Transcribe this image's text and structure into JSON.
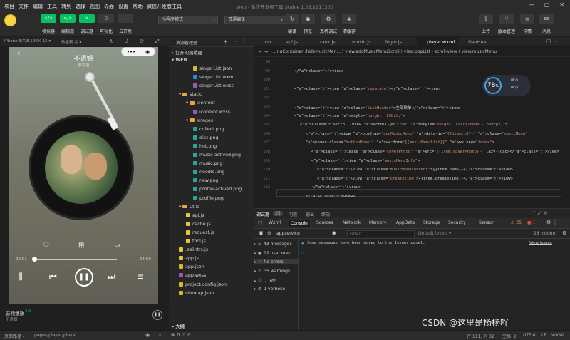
{
  "menus": [
    "项目",
    "文件",
    "编辑",
    "工具",
    "转到",
    "选择",
    "视图",
    "界面",
    "设置",
    "帮助",
    "微信开发者工具"
  ],
  "window_title": "web - 微信开发者工具 Stable 1.05.2111300",
  "toolbar": {
    "modes": [
      {
        "glyph": "</>",
        "label": "模拟器"
      },
      {
        "glyph": "</>",
        "label": "编辑器"
      },
      {
        "glyph": "≡",
        "label": "调试器"
      },
      {
        "glyph": "◫",
        "label": "可视化"
      },
      {
        "glyph": "☁",
        "label": "云开发"
      }
    ],
    "compile_mode": "小程序模式",
    "compile_type": "普通编译",
    "actions_mid": [
      {
        "icon": "↻",
        "label": "编译"
      },
      {
        "icon": "◉",
        "label": "预览"
      },
      {
        "icon": "⚙",
        "label": "真机调试"
      },
      {
        "icon": "◈",
        "label": "清缓存"
      }
    ],
    "actions_right": [
      {
        "icon": "⇪",
        "label": "上传"
      },
      {
        "icon": "⑂",
        "label": "版本管理"
      },
      {
        "icon": "≡",
        "label": "详情"
      },
      {
        "icon": "✉",
        "label": "消息"
      }
    ]
  },
  "simulator": {
    "device": "iPhone 6/7/8 100% 15 ▾",
    "hotreload": "热重载 关 ▾",
    "song_title": "不遗憾",
    "artist": "李荣浩",
    "time_current": "00:01",
    "time_total": "04:59",
    "progress": 0.02,
    "mini_title": "音频播放",
    "mini_sub": "不遗憾",
    "mini_extra": "4.0"
  },
  "explorer": {
    "title": "资源管理器",
    "open_editors": "打开的编辑器",
    "root": "WEB",
    "items": [
      {
        "name": "singerList.json",
        "type": "json",
        "indent": 3
      },
      {
        "name": "singerList.wxml",
        "type": "wxml",
        "indent": 3
      },
      {
        "name": "singerList.wxss",
        "type": "wxss",
        "indent": 3
      },
      {
        "name": "static",
        "type": "folder",
        "indent": 1
      },
      {
        "name": "iconfont",
        "type": "folder",
        "indent": 2
      },
      {
        "name": "iconfont.wxss",
        "type": "wxss",
        "indent": 3
      },
      {
        "name": "images",
        "type": "folder",
        "indent": 2
      },
      {
        "name": "collect.png",
        "type": "png",
        "indent": 3
      },
      {
        "name": "disc.png",
        "type": "png",
        "indent": 3
      },
      {
        "name": "hot.png",
        "type": "png",
        "indent": 3
      },
      {
        "name": "music-actived.png",
        "type": "png",
        "indent": 3
      },
      {
        "name": "music.png",
        "type": "png",
        "indent": 3
      },
      {
        "name": "needle.png",
        "type": "png",
        "indent": 3
      },
      {
        "name": "new.png",
        "type": "png",
        "indent": 3
      },
      {
        "name": "profile-actived.png",
        "type": "png",
        "indent": 3
      },
      {
        "name": "profile.png",
        "type": "png",
        "indent": 3
      },
      {
        "name": "utils",
        "type": "folder",
        "indent": 1
      },
      {
        "name": "api.js",
        "type": "js",
        "indent": 2
      },
      {
        "name": "cache.js",
        "type": "js",
        "indent": 2
      },
      {
        "name": "request.js",
        "type": "js",
        "indent": 2
      },
      {
        "name": "tool.js",
        "type": "js",
        "indent": 2
      },
      {
        "name": ".eslintrc.js",
        "type": "js",
        "indent": 1
      },
      {
        "name": "app.js",
        "type": "js",
        "indent": 1
      },
      {
        "name": "app.json",
        "type": "json",
        "indent": 1
      },
      {
        "name": "app.wxss",
        "type": "wxss",
        "indent": 1
      },
      {
        "name": "project.config.json",
        "type": "json",
        "indent": 1
      },
      {
        "name": "sitemap.json",
        "type": "json",
        "indent": 1
      }
    ],
    "outline": "大纲"
  },
  "editor": {
    "tabs": [
      "xss",
      "api.js",
      "rank.js",
      "music.js",
      "login.js",
      "player.wxml",
      "NavHea"
    ],
    "breadcrumb": "...nuContainer::hideMusicMen...   ⟩ view.addMusicMenuScroll   ⟩ view.popList   ⟩ scroll-view   ⟩ view.musicMenu",
    "line_numbers": [
      "98",
      "99",
      "100",
      "101",
      "102",
      "103",
      "104",
      "105",
      "106",
      "107",
      "108",
      "109",
      "110",
      "111",
      "112"
    ],
    "code_lines": [
      {
        "indent": 0,
        "text": ""
      },
      {
        "indent": 2,
        "text": "</view>"
      },
      {
        "indent": 0,
        "text": ""
      },
      {
        "indent": 2,
        "text": "<view class=\"separate\"></view>"
      },
      {
        "indent": 0,
        "text": ""
      },
      {
        "indent": 2,
        "text": "<view class=\"listHeader\">全部歌单</view>"
      },
      {
        "indent": 2,
        "text": "<view style=\"height: 100vh;\">"
      },
      {
        "indent": 3,
        "text": "<scroll-view scroll-y=\"true\" style=\"height: calc(100vh - 800rpx)\">"
      },
      {
        "indent": 4,
        "text": "<view bindtap=\"addMusicMenu\" data-id=\"{{item.id}}\" class=\"musicMenu\""
      },
      {
        "indent": 4,
        "text": "hover-class=\"buttonHover\" wx:for=\"{{musicMenuList}}\" wx:key=\"index\">"
      },
      {
        "indent": 5,
        "text": "<image class=\"coverPhoto\" src=\"{{item.coverPhoto}}\" lazy-load></view>"
      },
      {
        "indent": 5,
        "text": "<view class=\"musicMenuInfo\">"
      },
      {
        "indent": 6,
        "text": "<view class=\"musicMenuContent\">{{item.name}}</view>"
      },
      {
        "indent": 6,
        "text": "<view class=\"createTime\">{{item.createTime}}</view>"
      },
      {
        "indent": 5,
        "text": "</view>"
      },
      {
        "indent": 4,
        "text": "</view>"
      }
    ],
    "perf_value": "78",
    "perf_unit": "%",
    "perf_up": "0k/s",
    "perf_down": "0k/s"
  },
  "devtools": {
    "tabs": [
      "调试器",
      "35",
      "问题",
      "输出",
      "终端"
    ],
    "panel_tabs": [
      "Wxml",
      "Console",
      "Sources",
      "Network",
      "Memory",
      "AppData",
      "Storage",
      "Security",
      "Sensor"
    ],
    "badge_warn": "35",
    "badge_err": "1",
    "context": "appservice",
    "filter_placeholder": "Filter",
    "levels": "Default levels ▾",
    "hidden": "28 hidden",
    "sidebar": [
      {
        "label": "43 messages",
        "icon": "≡",
        "color": "#aaa"
      },
      {
        "label": "12 user mes...",
        "icon": "●",
        "color": "#aaa"
      },
      {
        "label": "No errors",
        "icon": "✕",
        "color": "#e04545"
      },
      {
        "label": "35 warnings",
        "icon": "⚠",
        "color": "#e8b030"
      },
      {
        "label": "7 info",
        "icon": "ⓘ",
        "color": "#4aa3df"
      },
      {
        "label": "1 verbose",
        "icon": "⚙",
        "color": "#aaa"
      }
    ],
    "message": "Some messages have been moved to the Issues panel.",
    "message_link": "View issues"
  },
  "statusbar": {
    "left": "页面路径 ▾",
    "path": "pages/player/player",
    "cursor": "行 111, 列 32",
    "spaces": "空格: 2",
    "encoding": "UTF-8",
    "eol": "LF",
    "lang": "WXML"
  },
  "watermark": "CSDN @这里是杨杨吖"
}
